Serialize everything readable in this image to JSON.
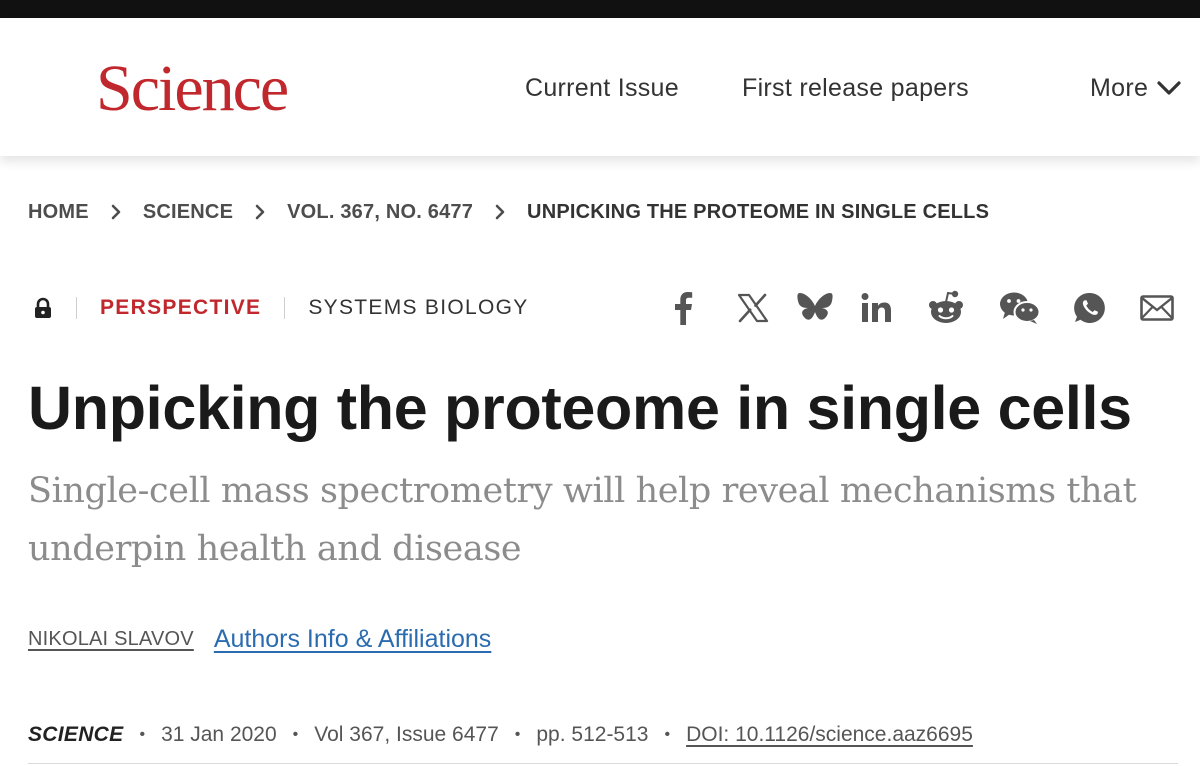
{
  "header": {
    "logo": "Science",
    "nav": {
      "current_issue": "Current Issue",
      "first_release": "First release papers",
      "more": "More"
    }
  },
  "breadcrumb": {
    "home": "HOME",
    "science": "SCIENCE",
    "volume": "VOL. 367, NO. 6477",
    "current": "UNPICKING THE PROTEOME IN SINGLE CELLS"
  },
  "article": {
    "access_icon": "lock-icon",
    "type": "PERSPECTIVE",
    "topic": "SYSTEMS BIOLOGY",
    "title": "Unpicking the proteome in single cells",
    "subtitle": "Single-cell mass spectrometry will help reveal mechanisms that underpin health and disease",
    "author": "NIKOLAI SLAVOV",
    "authors_link": "Authors Info & Affiliations"
  },
  "share_icons": [
    "facebook-icon",
    "x-icon",
    "bluesky-icon",
    "linkedin-icon",
    "reddit-icon",
    "wechat-icon",
    "whatsapp-icon",
    "email-icon"
  ],
  "citation": {
    "journal": "SCIENCE",
    "date": "31 Jan 2020",
    "volume": "Vol 367, Issue 6477",
    "pages": "pp. 512-513",
    "doi": "DOI: 10.1126/science.aaz6695"
  },
  "colors": {
    "brand_red": "#c0282d",
    "link_blue": "#2b6cb0",
    "subtitle_gray": "#8c8c8c"
  }
}
